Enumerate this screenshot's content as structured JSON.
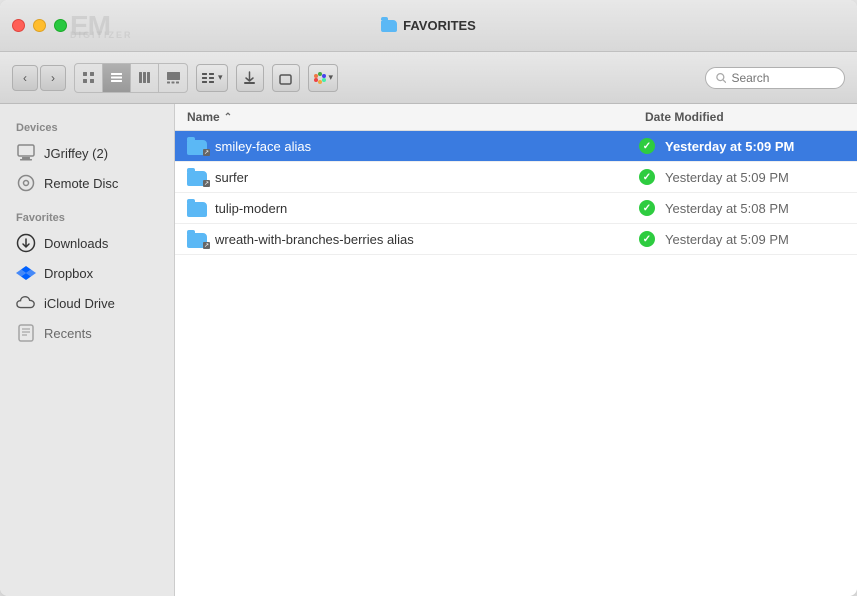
{
  "window": {
    "title": "FAVORITES",
    "watermark_line1": "EM",
    "watermark_line2": "DIGITIZER"
  },
  "traffic_lights": {
    "close": "close",
    "minimize": "minimize",
    "maximize": "maximize"
  },
  "toolbar": {
    "view_modes": [
      "grid",
      "list",
      "columns",
      "gallery",
      "arrange"
    ],
    "search_placeholder": "Search"
  },
  "sidebar": {
    "devices_header": "Devices",
    "devices": [
      {
        "id": "jgriffey",
        "label": "JGriffey (2)",
        "icon": "computer-icon"
      },
      {
        "id": "remote-disc",
        "label": "Remote Disc",
        "icon": "disc-icon"
      }
    ],
    "favorites_header": "Favorites",
    "favorites": [
      {
        "id": "downloads",
        "label": "Downloads",
        "icon": "downloads-icon"
      },
      {
        "id": "dropbox",
        "label": "Dropbox",
        "icon": "dropbox-icon"
      },
      {
        "id": "icloud",
        "label": "iCloud Drive",
        "icon": "icloud-icon"
      },
      {
        "id": "recents",
        "label": "Recents",
        "icon": "recents-icon"
      }
    ]
  },
  "file_list": {
    "col_name": "Name",
    "col_date": "Date Modified",
    "sort_col": "name",
    "sort_dir": "asc",
    "files": [
      {
        "id": "smiley-face-alias",
        "name": "smiley-face alias",
        "date": "Yesterday at 5:09 PM",
        "has_alias": true,
        "selected": true,
        "status": "synced"
      },
      {
        "id": "surfer",
        "name": "surfer",
        "date": "Yesterday at 5:09 PM",
        "has_alias": true,
        "selected": false,
        "status": "synced"
      },
      {
        "id": "tulip-modern",
        "name": "tulip-modern",
        "date": "Yesterday at 5:08 PM",
        "has_alias": false,
        "selected": false,
        "status": "synced"
      },
      {
        "id": "wreath-alias",
        "name": "wreath-with-branches-berries alias",
        "date": "Yesterday at 5:09 PM",
        "has_alias": true,
        "selected": false,
        "status": "synced"
      }
    ]
  }
}
